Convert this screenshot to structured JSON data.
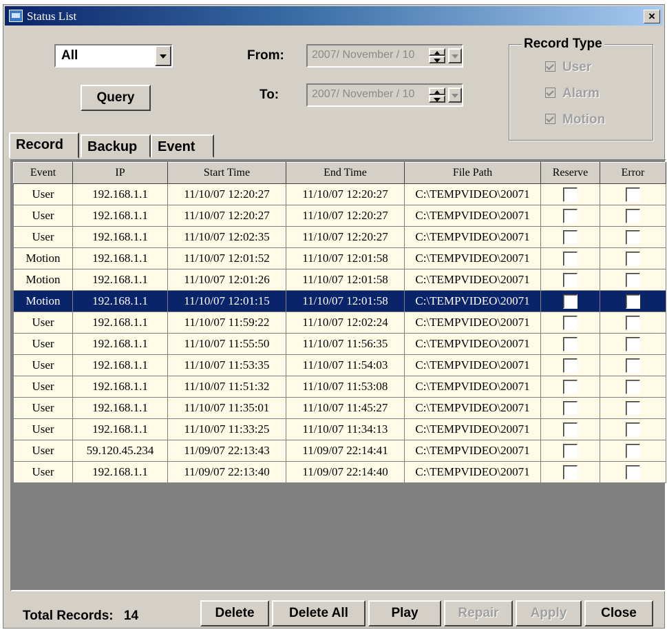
{
  "window": {
    "title": "Status List",
    "close_symbol": "×"
  },
  "filter": {
    "type_selected": "All",
    "query_label": "Query",
    "from_label": "From:",
    "to_label": "To:",
    "from_value": "2007/ November / 10",
    "to_value": "2007/ November / 10"
  },
  "record_type": {
    "title": "Record Type",
    "options": [
      {
        "label": "User",
        "checked": true,
        "enabled": false
      },
      {
        "label": "Alarm",
        "checked": true,
        "enabled": false
      },
      {
        "label": "Motion",
        "checked": true,
        "enabled": false
      }
    ]
  },
  "tabs": [
    "Record",
    "Backup",
    "Event"
  ],
  "table": {
    "columns": [
      "Event",
      "IP",
      "Start Time",
      "End Time",
      "File Path",
      "Reserve",
      "Error"
    ],
    "rows": [
      {
        "event": "User",
        "ip": "192.168.1.1",
        "start": "11/10/07 12:20:27",
        "end": "11/10/07 12:20:27",
        "path": "C:\\TEMPVIDEO\\20071",
        "reserve": false,
        "error": false
      },
      {
        "event": "User",
        "ip": "192.168.1.1",
        "start": "11/10/07 12:20:27",
        "end": "11/10/07 12:20:27",
        "path": "C:\\TEMPVIDEO\\20071",
        "reserve": false,
        "error": false
      },
      {
        "event": "User",
        "ip": "192.168.1.1",
        "start": "11/10/07 12:02:35",
        "end": "11/10/07 12:20:27",
        "path": "C:\\TEMPVIDEO\\20071",
        "reserve": false,
        "error": false
      },
      {
        "event": "Motion",
        "ip": "192.168.1.1",
        "start": "11/10/07 12:01:52",
        "end": "11/10/07 12:01:58",
        "path": "C:\\TEMPVIDEO\\20071",
        "reserve": false,
        "error": false
      },
      {
        "event": "Motion",
        "ip": "192.168.1.1",
        "start": "11/10/07 12:01:26",
        "end": "11/10/07 12:01:58",
        "path": "C:\\TEMPVIDEO\\20071",
        "reserve": false,
        "error": false
      },
      {
        "event": "Motion",
        "ip": "192.168.1.1",
        "start": "11/10/07 12:01:15",
        "end": "11/10/07 12:01:58",
        "path": "C:\\TEMPVIDEO\\20071",
        "reserve": false,
        "error": false,
        "selected": true
      },
      {
        "event": "User",
        "ip": "192.168.1.1",
        "start": "11/10/07 11:59:22",
        "end": "11/10/07 12:02:24",
        "path": "C:\\TEMPVIDEO\\20071",
        "reserve": false,
        "error": false
      },
      {
        "event": "User",
        "ip": "192.168.1.1",
        "start": "11/10/07 11:55:50",
        "end": "11/10/07 11:56:35",
        "path": "C:\\TEMPVIDEO\\20071",
        "reserve": false,
        "error": false
      },
      {
        "event": "User",
        "ip": "192.168.1.1",
        "start": "11/10/07 11:53:35",
        "end": "11/10/07 11:54:03",
        "path": "C:\\TEMPVIDEO\\20071",
        "reserve": false,
        "error": false
      },
      {
        "event": "User",
        "ip": "192.168.1.1",
        "start": "11/10/07 11:51:32",
        "end": "11/10/07 11:53:08",
        "path": "C:\\TEMPVIDEO\\20071",
        "reserve": false,
        "error": false
      },
      {
        "event": "User",
        "ip": "192.168.1.1",
        "start": "11/10/07 11:35:01",
        "end": "11/10/07 11:45:27",
        "path": "C:\\TEMPVIDEO\\20071",
        "reserve": false,
        "error": false
      },
      {
        "event": "User",
        "ip": "192.168.1.1",
        "start": "11/10/07 11:33:25",
        "end": "11/10/07 11:34:13",
        "path": "C:\\TEMPVIDEO\\20071",
        "reserve": false,
        "error": false
      },
      {
        "event": "User",
        "ip": "59.120.45.234",
        "start": "11/09/07 22:13:43",
        "end": "11/09/07 22:14:41",
        "path": "C:\\TEMPVIDEO\\20071",
        "reserve": false,
        "error": false
      },
      {
        "event": "User",
        "ip": "192.168.1.1",
        "start": "11/09/07 22:13:40",
        "end": "11/09/07 22:14:40",
        "path": "C:\\TEMPVIDEO\\20071",
        "reserve": false,
        "error": false
      }
    ]
  },
  "footer": {
    "total_label": "Total Records:",
    "total_value": "14",
    "buttons": {
      "delete": "Delete",
      "delete_all": "Delete All",
      "play": "Play",
      "repair": "Repair",
      "apply": "Apply",
      "close": "Close"
    }
  },
  "colors": {
    "face": "#d4d0c8",
    "row_bg": "#fffbe6",
    "selection": "#0a246a",
    "grid_empty": "#808080"
  },
  "icons": {
    "app": "status-list-app-icon",
    "close": "close-icon",
    "dropdown": "chevron-down-icon",
    "spin": "spin-arrows-icon"
  }
}
